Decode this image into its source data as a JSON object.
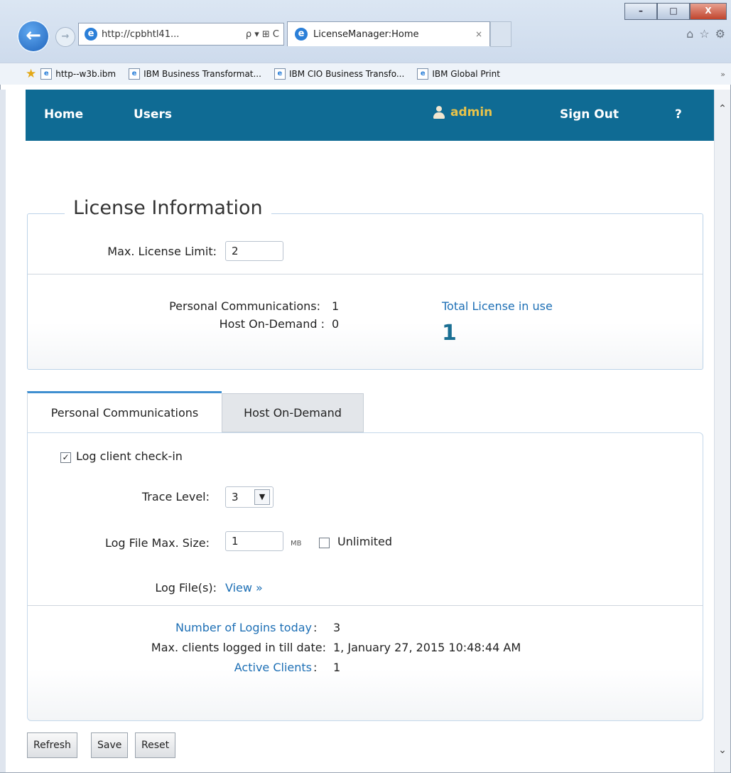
{
  "browser": {
    "window_controls": {
      "minimize": "–",
      "maximize": "□",
      "close": "X"
    },
    "address": "http://cpbhtl41...",
    "address_controls": "ρ ▾ ⊞ C",
    "tab_title": "LicenseManager:Home",
    "tab_close": "×",
    "favorites": [
      "http--w3b.ibm",
      "IBM Business Transformat...",
      "IBM CIO Business Transfo...",
      "IBM Global Print"
    ],
    "more": "»"
  },
  "nav": {
    "home": "Home",
    "users": "Users",
    "user_name": "admin",
    "sign_out": "Sign Out",
    "help": "?"
  },
  "license": {
    "title": "License Information",
    "max_limit_label": "Max. License Limit:",
    "max_limit_value": "2",
    "pcomm_label": "Personal Communications:",
    "pcomm_value": "1",
    "hod_label": "Host On-Demand :",
    "hod_value": "0",
    "total_label": "Total License in use",
    "total_value": "1"
  },
  "tabs": {
    "active": "Personal Communications",
    "inactive": "Host On-Demand"
  },
  "panel": {
    "log_checkin_label": "Log client check-in",
    "log_checkin_checked": true,
    "trace_label": "Trace Level:",
    "trace_value": "3",
    "logsize_label": "Log File Max. Size:",
    "logsize_value": "1",
    "logsize_unit": "MB",
    "unlimited_label": "Unlimited",
    "unlimited_checked": false,
    "logfiles_label": "Log File(s):",
    "logfiles_link": "View »",
    "logins_today_label": "Number of Logins today",
    "logins_today_value": "3",
    "max_clients_label": "Max. clients logged in till date:",
    "max_clients_value": "1, January 27, 2015 10:48:44 AM",
    "active_clients_label": "Active Clients",
    "active_clients_value": "1",
    "colon": ":"
  },
  "buttons": {
    "refresh": "Refresh",
    "save": "Save",
    "reset": "Reset"
  },
  "colors": {
    "nav_bg": "#0f6b94",
    "link": "#1d6fb5",
    "accent_number": "#1a6f93",
    "admin": "#e8c34a"
  }
}
